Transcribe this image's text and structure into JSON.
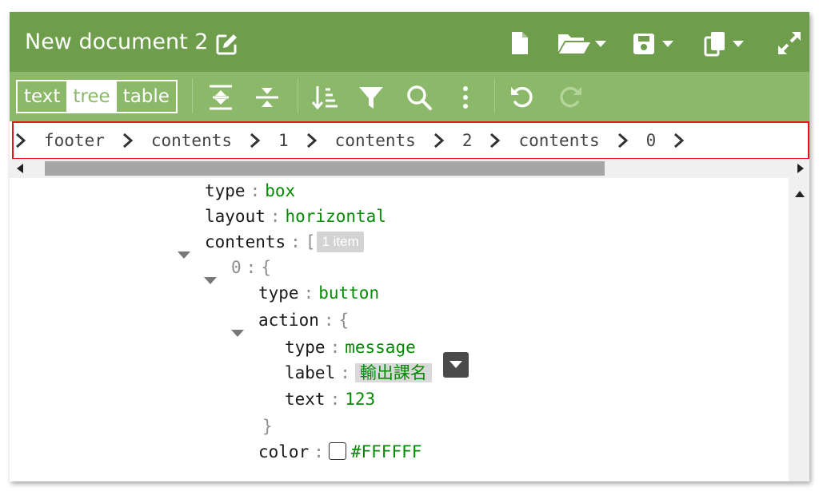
{
  "window": {
    "title": "New document 2"
  },
  "toolbar": {
    "modes": [
      "text",
      "tree",
      "table"
    ],
    "active_mode": "tree"
  },
  "breadcrumb": [
    "footer",
    "contents",
    "1",
    "contents",
    "2",
    "contents",
    "0"
  ],
  "tree": {
    "rows": [
      {
        "key": "type",
        "value": "box"
      },
      {
        "key": "layout",
        "value": "horizontal"
      },
      {
        "key": "contents",
        "open": "[",
        "badge": "1 item"
      },
      {
        "key": "0",
        "open": "{"
      },
      {
        "key": "type",
        "value": "button"
      },
      {
        "key": "action",
        "open": "{"
      },
      {
        "key": "type",
        "value": "message"
      },
      {
        "key": "label",
        "value": "輸出課名"
      },
      {
        "key": "text",
        "value": "123"
      },
      {
        "close": "}"
      },
      {
        "key": "color",
        "value": "#FFFFFF"
      }
    ]
  },
  "colors": {
    "title_bar": "#6e9e4b",
    "toolbar": "#8cb86a",
    "value_text": "#048a04",
    "highlight_border": "#e2151b"
  }
}
